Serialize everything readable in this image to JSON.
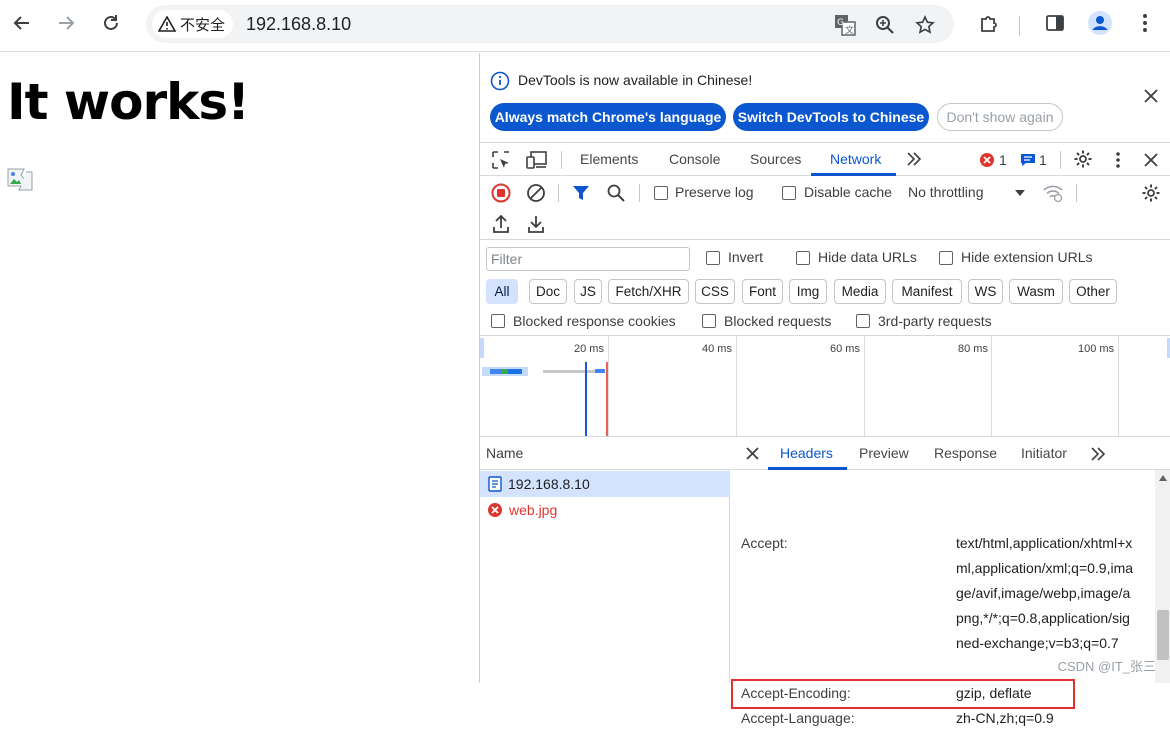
{
  "browser": {
    "security_label": "不安全",
    "url": "192.168.8.10"
  },
  "page": {
    "heading": "It works!"
  },
  "devtools": {
    "info_text": "DevTools is now available in Chinese!",
    "buttons": {
      "always_match": "Always match Chrome's language",
      "switch": "Switch DevTools to Chinese",
      "dont_show": "Don't show again"
    },
    "tabs": [
      "Elements",
      "Console",
      "Sources",
      "Network"
    ],
    "active_tab": "Network",
    "error_count": "1",
    "message_count": "1",
    "network": {
      "preserve_log": "Preserve log",
      "disable_cache": "Disable cache",
      "throttling": "No throttling",
      "filter_placeholder": "Filter",
      "invert": "Invert",
      "hide_data_urls": "Hide data URLs",
      "hide_extension_urls": "Hide extension URLs",
      "type_filters": [
        "All",
        "Doc",
        "JS",
        "Fetch/XHR",
        "CSS",
        "Font",
        "Img",
        "Media",
        "Manifest",
        "WS",
        "Wasm",
        "Other"
      ],
      "blocked_cookies": "Blocked response cookies",
      "blocked_requests": "Blocked requests",
      "third_party": "3rd-party requests",
      "timeline_ticks": [
        "20 ms",
        "40 ms",
        "60 ms",
        "80 ms",
        "100 ms"
      ]
    },
    "requests": {
      "name_header": "Name",
      "items": [
        "192.168.8.10",
        "web.jpg"
      ]
    },
    "detail": {
      "tabs": [
        "Headers",
        "Preview",
        "Response",
        "Initiator"
      ],
      "headers": [
        {
          "key": "Accept:",
          "value": "text/html,application/xhtml+xml,application/xml;q=0.9,image/avif,image/webp,image/apng,*/*;q=0.8,application/signed-exchange;v=b3;q=0.7"
        },
        {
          "key": "Accept-Encoding:",
          "value": "gzip, deflate"
        },
        {
          "key": "Accept-Language:",
          "value": "zh-CN,zh;q=0.9"
        }
      ]
    }
  },
  "watermark": "CSDN @IT_张三"
}
